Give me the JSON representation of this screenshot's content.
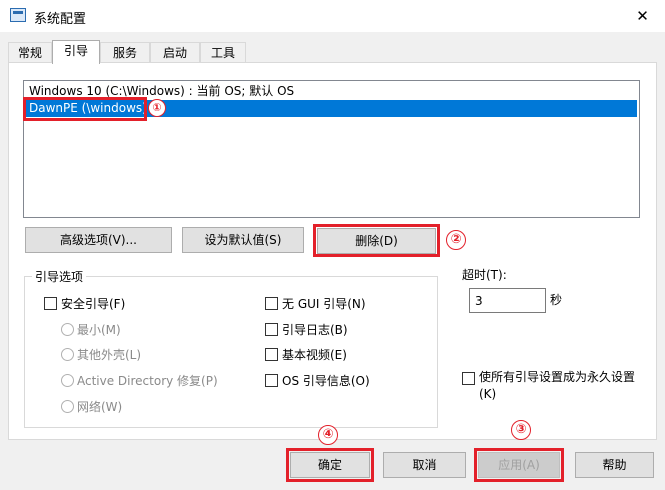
{
  "window": {
    "title": "系统配置",
    "close": "✕"
  },
  "tabs": [
    "常规",
    "引导",
    "服务",
    "启动",
    "工具"
  ],
  "os_list": [
    "Windows 10 (C:\\Windows) : 当前 OS; 默认 OS",
    "DawnPE (\\windows)"
  ],
  "buttons": {
    "advanced": "高级选项(V)...",
    "set_default": "设为默认值(S)",
    "delete": "删除(D)",
    "ok": "确定",
    "cancel": "取消",
    "apply": "应用(A)",
    "help": "帮助"
  },
  "boot_options": {
    "title": "引导选项",
    "safe_boot": "安全引导(F)",
    "minimal": "最小(M)",
    "alt_shell": "其他外壳(L)",
    "ad_repair": "Active Directory 修复(P)",
    "network": "网络(W)",
    "no_gui": "无 GUI 引导(N)",
    "boot_log": "引导日志(B)",
    "base_video": "基本视频(E)",
    "os_info": "OS 引导信息(O)"
  },
  "timeout": {
    "label": "超时(T):",
    "value": "3",
    "unit": "秒"
  },
  "permanent": {
    "line1": "使所有引导设置成为永久设置",
    "line2": "(K)"
  },
  "badges": [
    "①",
    "②",
    "③",
    "④"
  ]
}
